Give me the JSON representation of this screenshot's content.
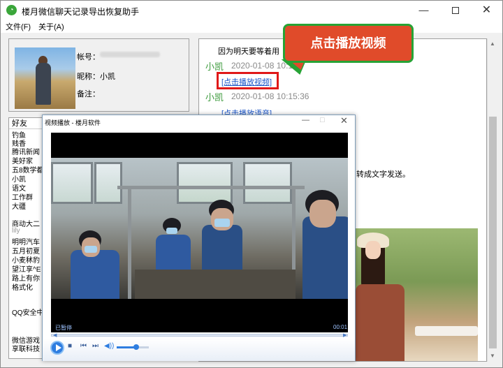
{
  "window": {
    "title": "楼月微信聊天记录导出恢复助手",
    "icon": "wechat-green-icon",
    "minimize_glyph": "—",
    "close_glyph": "✕"
  },
  "menu": {
    "file": "文件(F)",
    "about": "关于(A)"
  },
  "profile": {
    "account_label": "帐号：",
    "nickname_label": "昵称：小凯",
    "remark_label": "备注："
  },
  "friend_list": {
    "header": "好友",
    "items": [
      "钓鱼",
      "贱香",
      "腾讯新闻",
      "美好家",
      "五8数学都",
      "小凯",
      "语文",
      "工作群",
      "大疆",
      "商动大二",
      "lily",
      "明明汽车",
      "五月初夏",
      "小麦秫豹",
      "望江享^E",
      "路上有你",
      "格式化",
      "QQ安全中",
      "微信游戏",
      "享联科技"
    ]
  },
  "chat": {
    "line1": "因为明天要等着用",
    "sender1": "小凯",
    "time1": "2020-01-08 10:15:",
    "link_video": "[点击播放视频]",
    "sender2": "小凯",
    "time2": "2020-01-08 10:15:36",
    "link_audio": "[点击播放语音]",
    "line2": "转成文字发送。"
  },
  "callout": {
    "text": "点击播放视频",
    "accent_color": "#e04b2a",
    "border_color": "#27a335"
  },
  "video_player": {
    "title": "视频播放 - 楼月软件",
    "status": "已暂停",
    "time": "00:01",
    "volume": 0.6
  }
}
